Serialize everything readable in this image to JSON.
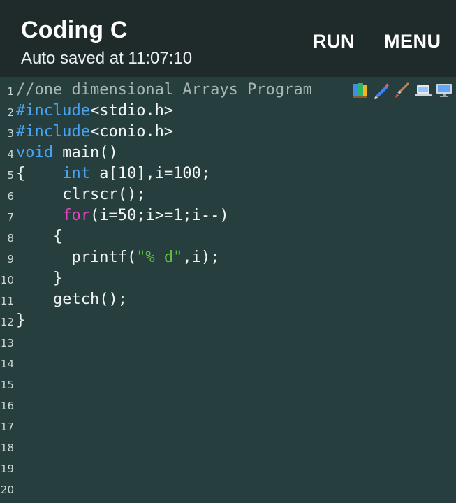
{
  "toolbar": {
    "title": "Coding C",
    "subtitle": "Auto saved at 11:07:10",
    "run_label": "RUN",
    "menu_label": "MENU"
  },
  "editor": {
    "lines": [
      {
        "num": "1",
        "segments": [
          {
            "text": "//one dimensional Arrays Program ",
            "cls": "comment"
          }
        ]
      },
      {
        "num": "2",
        "segments": [
          {
            "text": "#include",
            "cls": "pre"
          },
          {
            "text": "<stdio.h>",
            "cls": ""
          }
        ]
      },
      {
        "num": "3",
        "segments": [
          {
            "text": "#include",
            "cls": "pre"
          },
          {
            "text": "<conio.h>",
            "cls": ""
          }
        ]
      },
      {
        "num": "4",
        "segments": [
          {
            "text": "void",
            "cls": "kw"
          },
          {
            "text": " main()",
            "cls": ""
          }
        ]
      },
      {
        "num": "5",
        "segments": [
          {
            "text": "{    ",
            "cls": ""
          },
          {
            "text": "int",
            "cls": "kw"
          },
          {
            "text": " a[10],i=100;",
            "cls": ""
          }
        ]
      },
      {
        "num": "6",
        "segments": [
          {
            "text": "     clrscr();",
            "cls": ""
          }
        ]
      },
      {
        "num": "7",
        "segments": [
          {
            "text": "     ",
            "cls": ""
          },
          {
            "text": "for",
            "cls": "kwp"
          },
          {
            "text": "(i=50;i>=1;i--)",
            "cls": ""
          }
        ]
      },
      {
        "num": "8",
        "segments": [
          {
            "text": "    {",
            "cls": ""
          }
        ]
      },
      {
        "num": "9",
        "segments": [
          {
            "text": "      printf(",
            "cls": ""
          },
          {
            "text": "\"% d\"",
            "cls": "str"
          },
          {
            "text": ",i);",
            "cls": ""
          }
        ]
      },
      {
        "num": "10",
        "segments": [
          {
            "text": "    }",
            "cls": ""
          }
        ]
      },
      {
        "num": "11",
        "segments": [
          {
            "text": "    getch();",
            "cls": ""
          }
        ]
      },
      {
        "num": "12",
        "segments": [
          {
            "text": "}",
            "cls": ""
          }
        ]
      },
      {
        "num": "13",
        "segments": []
      },
      {
        "num": "14",
        "segments": []
      },
      {
        "num": "15",
        "segments": []
      },
      {
        "num": "16",
        "segments": []
      },
      {
        "num": "17",
        "segments": []
      },
      {
        "num": "18",
        "segments": []
      },
      {
        "num": "19",
        "segments": []
      },
      {
        "num": "20",
        "segments": []
      }
    ],
    "line1_emojis": [
      "books-icon",
      "pencil-icon",
      "paintbrush-icon",
      "laptop-icon",
      "desktop-computer-icon"
    ]
  },
  "colors": {
    "toolbar_bg": "#1f2b2b",
    "editor_bg": "#263e3e",
    "keyword": "#4aa3f0",
    "control_keyword": "#e243c2",
    "string": "#5fbf3f",
    "comment": "#a9b6b6"
  }
}
